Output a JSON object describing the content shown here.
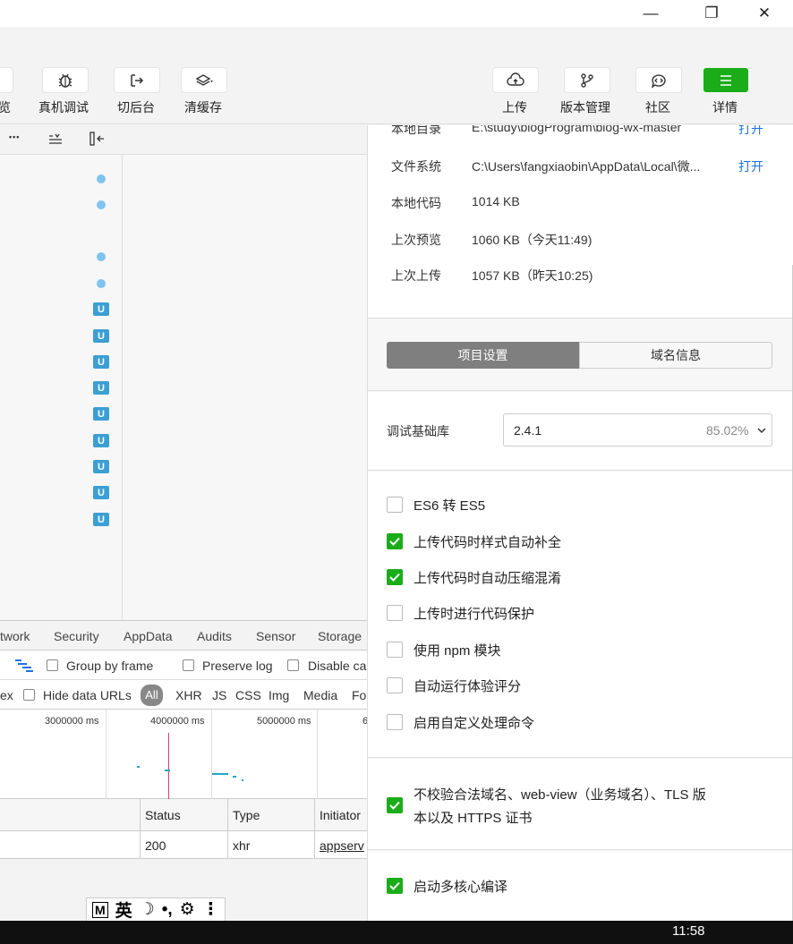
{
  "window": {
    "minimize_glyph": "—",
    "maximize_glyph": "❐",
    "close_glyph": "✕"
  },
  "toolbar": {
    "partial_label": "览",
    "real_device_debug": "真机调试",
    "background": "切后台",
    "clear_cache": "清缓存",
    "upload": "上传",
    "version_mgmt": "版本管理",
    "community": "社区",
    "details": "详情"
  },
  "panel_toolbar": {
    "more_glyph": "•••"
  },
  "tree": {
    "badge": "U"
  },
  "devtools": {
    "tabs": [
      "twork",
      "Security",
      "AppData",
      "Audits",
      "Sensor",
      "Storage"
    ],
    "group_by_frame": "Group by frame",
    "preserve_log": "Preserve log",
    "disable_cache": "Disable ca",
    "regex_partial": "ex",
    "hide_data_urls": "Hide data URLs",
    "filters": [
      "All",
      "XHR",
      "JS",
      "CSS",
      "Img",
      "Media",
      "Fo"
    ],
    "timeline_labels": [
      "3000000 ms",
      "4000000 ms",
      "5000000 ms",
      "6"
    ],
    "table_headers": [
      "Status",
      "Type",
      "Initiator"
    ],
    "row": {
      "status": "200",
      "type": "xhr",
      "initiator": "appserv"
    }
  },
  "ime": {
    "m": "M",
    "lang": "英",
    "moon": "☽",
    "punct": "•,",
    "gear": "⚙",
    "menu": "⋮"
  },
  "taskbar": {
    "time": "11:58"
  },
  "details": {
    "info": [
      {
        "label": "本地目录",
        "value": "E:\\study\\blogProgram\\blog-wx-master",
        "link": "打开"
      },
      {
        "label": "文件系统",
        "value": "C:\\Users\\fangxiaobin\\AppData\\Local\\微...",
        "link": "打开"
      },
      {
        "label": "本地代码",
        "value": "1014 KB"
      },
      {
        "label": "上次预览",
        "value": "1060 KB（今天11:49)"
      },
      {
        "label": "上次上传",
        "value": "1057 KB（昨天10:25)"
      }
    ],
    "tabs": {
      "project_settings": "项目设置",
      "domain_info": "域名信息"
    },
    "base_lib": {
      "label": "调试基础库",
      "version": "2.4.1",
      "percent": "85.02%"
    },
    "options": [
      {
        "label": "ES6 转 ES5",
        "checked": false
      },
      {
        "label": "上传代码时样式自动补全",
        "checked": true
      },
      {
        "label": "上传代码时自动压缩混淆",
        "checked": true
      },
      {
        "label": "上传时进行代码保护",
        "checked": false
      },
      {
        "label": "使用 npm 模块",
        "checked": false
      },
      {
        "label": "自动运行体验评分",
        "checked": false
      },
      {
        "label": "启用自定义处理命令",
        "checked": false
      }
    ],
    "no_verify": {
      "line1": "不校验合法域名、web-view（业务域名）、TLS 版",
      "line2": "本以及 HTTPS 证书",
      "checked": true
    },
    "multicore": {
      "label": "启动多核心编译",
      "checked": true
    }
  },
  "colors": {
    "accent_green": "#1aad19",
    "link_blue": "#1a73e8"
  }
}
